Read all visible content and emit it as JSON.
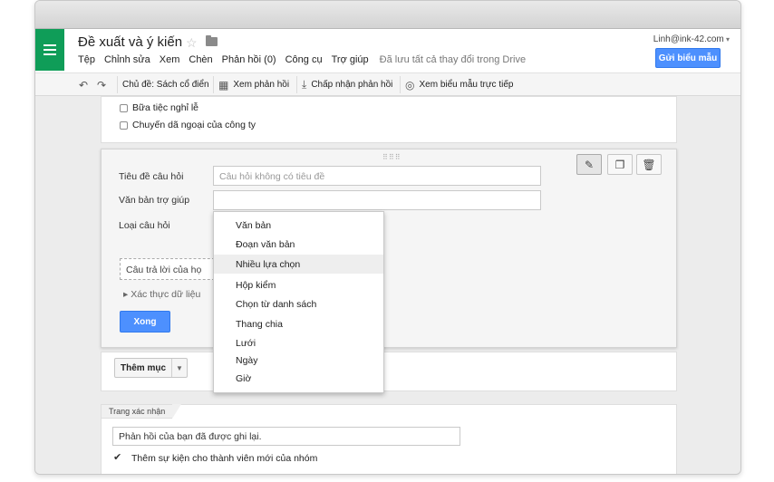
{
  "app": {
    "doc_title": "Đề xuất và ý kiến",
    "user": "Linh@ink-42.com",
    "send_button": "Gửi biểu mẫu",
    "menus": [
      "Tệp",
      "Chỉnh sửa",
      "Xem",
      "Chèn",
      "Phản hồi (0)",
      "Công cụ",
      "Trợ giúp"
    ],
    "saved_status": "Đã lưu tất cả thay đổi trong Drive"
  },
  "toolbar": {
    "undo_icon": "undo-icon",
    "redo_icon": "redo-icon",
    "theme": "Chủ đề: Sách cổ điển",
    "view_responses": "Xem phản hồi",
    "accept_responses": "Chấp nhận phản hồi",
    "view_live": "Xem biểu mẫu trực tiếp"
  },
  "above_options": [
    "Bữa tiệc nghỉ lễ",
    "Chuyến dã ngoại của công ty"
  ],
  "question_editor": {
    "title_label": "Tiêu đề câu hỏi",
    "title_placeholder": "Câu hỏi không có tiêu đề",
    "help_label": "Văn bản trợ giúp",
    "help_value": "",
    "type_label": "Loại câu hỏi",
    "answer_preview": "Câu trả lời của họ",
    "data_validation": "Xác thực dữ liệu",
    "done_button": "Xong",
    "icons": [
      "pencil-icon",
      "duplicate-icon",
      "trash-icon"
    ]
  },
  "type_dropdown": {
    "options": [
      "Văn bản",
      "Đoạn văn bản",
      "Nhiều lựa chọn",
      "Hộp kiểm",
      "Chọn từ danh sách",
      "Thang chia",
      "Lưới",
      "Ngày",
      "Giờ"
    ],
    "highlighted": "Nhiều lựa chọn"
  },
  "add_item": {
    "label": "Thêm mục"
  },
  "confirmation": {
    "tab_label": "Trang xác nhận",
    "message": "Phản hồi của bạn đã được ghi lại.",
    "checkbox_label": "Thêm sự kiện cho thành viên mới của nhóm",
    "checkbox_checked": true
  }
}
